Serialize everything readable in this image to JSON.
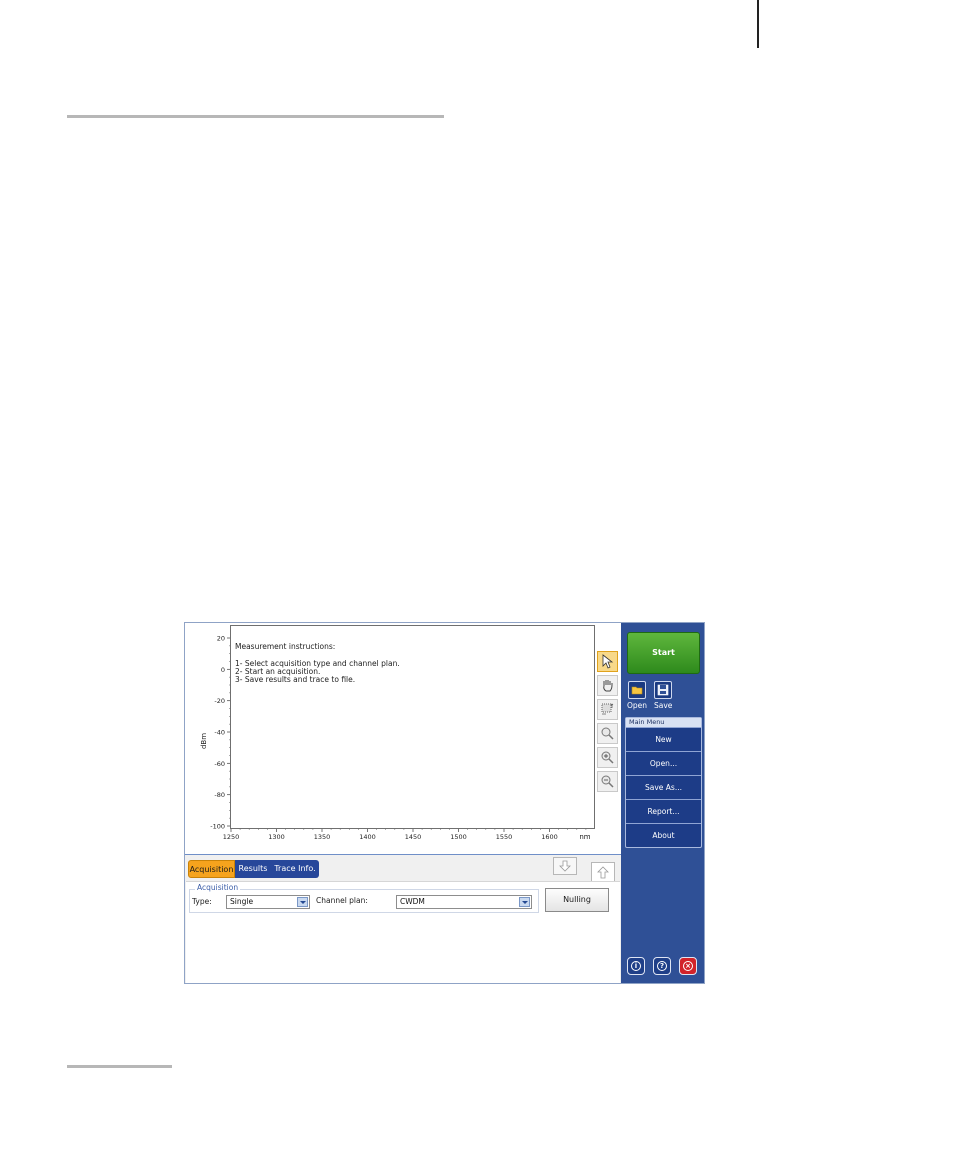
{
  "graph": {
    "y_unit_label": "dBm",
    "x_unit_label": "nm",
    "y_ticks": [
      "20",
      "0",
      "-20",
      "-40",
      "-60",
      "-80",
      "-100"
    ],
    "x_ticks": [
      "1250",
      "1300",
      "1350",
      "1400",
      "1450",
      "1500",
      "1550",
      "1600"
    ],
    "instructions": {
      "title": "Measurement instructions:",
      "steps": [
        "1- Select acquisition type and channel plan.",
        "2- Start an acquisition.",
        "3- Save results and trace to file."
      ]
    }
  },
  "toolbar": {
    "tools": [
      "pointer-icon",
      "hand-pan-icon",
      "zoom-area-icon",
      "zoom-reset-icon",
      "zoom-in-icon",
      "zoom-out-icon"
    ]
  },
  "tabs": [
    "Acquisition",
    "Results",
    "Trace Info."
  ],
  "acquisition": {
    "group_title": "Acquisition",
    "type_label": "Type:",
    "type_value": "Single",
    "channel_plan_label": "Channel plan:",
    "channel_plan_value": "CWDM",
    "nulling_label": "Nulling"
  },
  "sidebar": {
    "start_label": "Start",
    "open_label": "Open",
    "save_label": "Save",
    "main_menu_title": "Main Menu",
    "menu_items": [
      "New",
      "Open...",
      "Save As...",
      "Report...",
      "About"
    ]
  },
  "colors": {
    "sidebar_bg": "#2f5096",
    "start_green": "#3f9e2a",
    "tab_active": "#f6a31d",
    "tab_inactive": "#27479a",
    "exit_red": "#d2232a"
  }
}
